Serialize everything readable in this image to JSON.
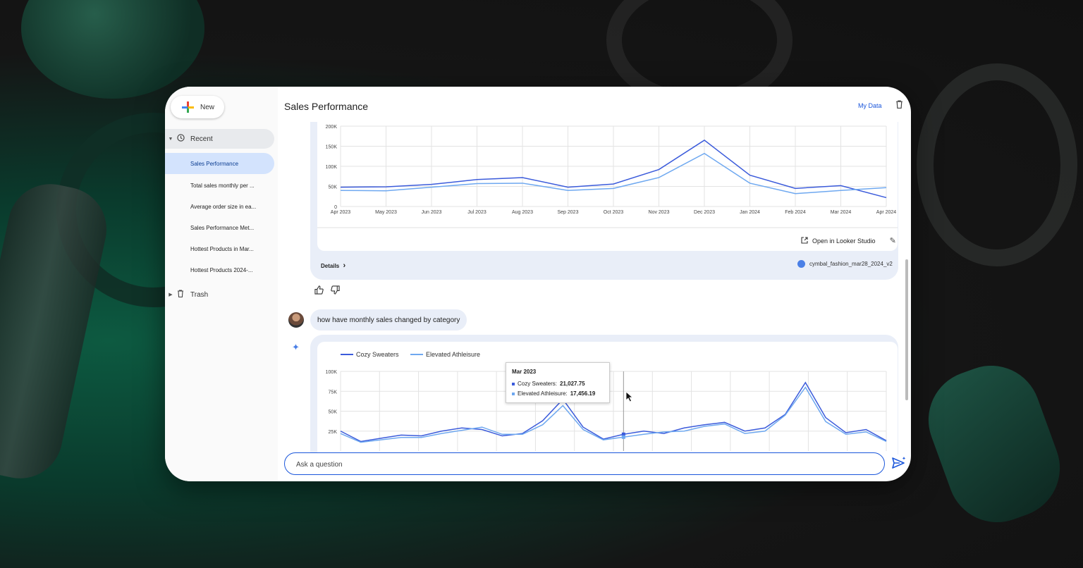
{
  "window": {
    "title": "Sales Performance",
    "my_data_label": "My Data"
  },
  "sidebar": {
    "new_label": "New",
    "recent_label": "Recent",
    "trash_label": "Trash",
    "items": [
      {
        "label": "Sales Performance"
      },
      {
        "label": "Total sales monthly per ..."
      },
      {
        "label": "Average order size in ea..."
      },
      {
        "label": "Sales Performance Met..."
      },
      {
        "label": "Hottest Products in Mar..."
      },
      {
        "label": "Hottest Products 2024-..."
      }
    ]
  },
  "response1": {
    "open_looker_label": "Open in Looker Studio",
    "details_label": "Details",
    "dataset_label": "cymbal_fashion_mar28_2024_v2"
  },
  "user_message": {
    "text": "how have monthly sales changed by category"
  },
  "ask": {
    "placeholder": "Ask a question"
  },
  "tooltip": {
    "title": "Mar 2023",
    "rows": [
      {
        "label": "Cozy Sweaters:",
        "value": "21,027.75"
      },
      {
        "label": "Elevated Athleisure:",
        "value": "17,456.19"
      }
    ]
  },
  "colors": {
    "series_dark": "#3b5bdb",
    "series_light": "#6ea8f0",
    "accent": "#1a56db"
  },
  "chart_data": [
    {
      "type": "line",
      "title": "",
      "xlabel": "",
      "ylabel": "",
      "categories": [
        "Apr 2023",
        "May 2023",
        "Jun 2023",
        "Jul 2023",
        "Aug 2023",
        "Sep 2023",
        "Oct 2023",
        "Nov 2023",
        "Dec 2023",
        "Jan 2024",
        "Feb 2024",
        "Mar 2024",
        "Apr 2024"
      ],
      "y_ticks": [
        "0",
        "50K",
        "100K",
        "150K",
        "200K"
      ],
      "ylim": [
        0,
        200000
      ],
      "grid": true,
      "series": [
        {
          "values": [
            48000,
            49000,
            55000,
            67000,
            72000,
            48000,
            56000,
            92000,
            165000,
            78000,
            45000,
            52000,
            22000
          ]
        },
        {
          "values": [
            40000,
            39000,
            48000,
            57000,
            58000,
            40000,
            45000,
            72000,
            132000,
            58000,
            32000,
            40000,
            47000
          ]
        }
      ]
    },
    {
      "type": "line",
      "title": "",
      "xlabel": "",
      "ylabel": "",
      "y_ticks": [
        "25K",
        "50K",
        "75K",
        "100K"
      ],
      "ylim": [
        0,
        100000
      ],
      "grid": true,
      "legend": "top-left",
      "series": [
        {
          "name": "Cozy Sweaters",
          "values": [
            25000,
            12000,
            16000,
            20000,
            19000,
            25000,
            29000,
            27000,
            19000,
            22000,
            38000,
            65000,
            30000,
            15000,
            21027.75,
            25000,
            22000,
            29000,
            33000,
            36000,
            25000,
            29000,
            46000,
            86000,
            42000,
            23000,
            27000,
            13000
          ]
        },
        {
          "name": "Elevated Athleisure",
          "values": [
            22000,
            11000,
            14000,
            17000,
            17000,
            22000,
            26000,
            30000,
            21000,
            21000,
            33000,
            57000,
            27000,
            14000,
            17456.19,
            21000,
            24000,
            25000,
            31000,
            34000,
            22000,
            25000,
            45000,
            80000,
            37000,
            21000,
            24000,
            12000
          ]
        }
      ]
    }
  ]
}
